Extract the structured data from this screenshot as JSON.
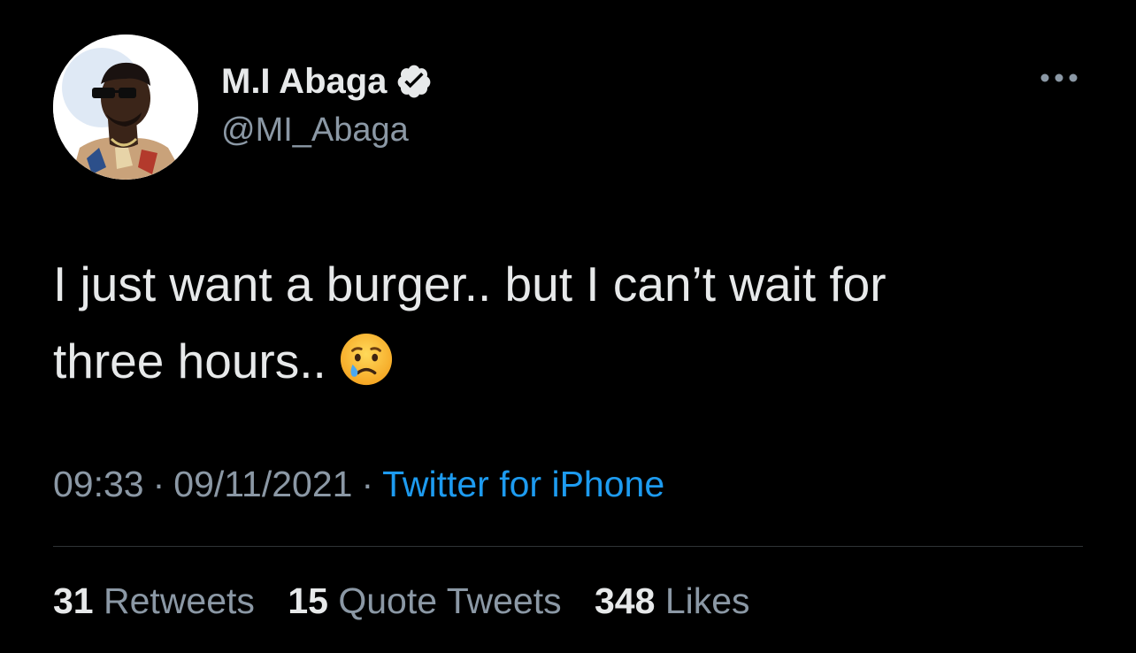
{
  "author": {
    "display_name": "M.I Abaga",
    "handle": "@MI_Abaga",
    "verified": true,
    "avatar_icon": "profile-photo"
  },
  "tweet": {
    "text_line1": "I just want a burger.. but I can’t wait for",
    "text_line2": "three hours..",
    "emoji_icon": "crying-face-emoji"
  },
  "meta": {
    "time": "09:33",
    "separator": "·",
    "date": "09/11/2021",
    "source": "Twitter for iPhone"
  },
  "stats": {
    "retweets_count": "31",
    "retweets_label": "Retweets",
    "quotes_count": "15",
    "quotes_label": "Quote Tweets",
    "likes_count": "348",
    "likes_label": "Likes"
  },
  "colors": {
    "background": "#000000",
    "primary_text": "#e7e9ea",
    "secondary_text": "#8b98a5",
    "link": "#1d9bf0",
    "divider": "#2f3336"
  },
  "menu_icon": "more-horizontal-icon",
  "verified_icon": "verified-badge-icon"
}
